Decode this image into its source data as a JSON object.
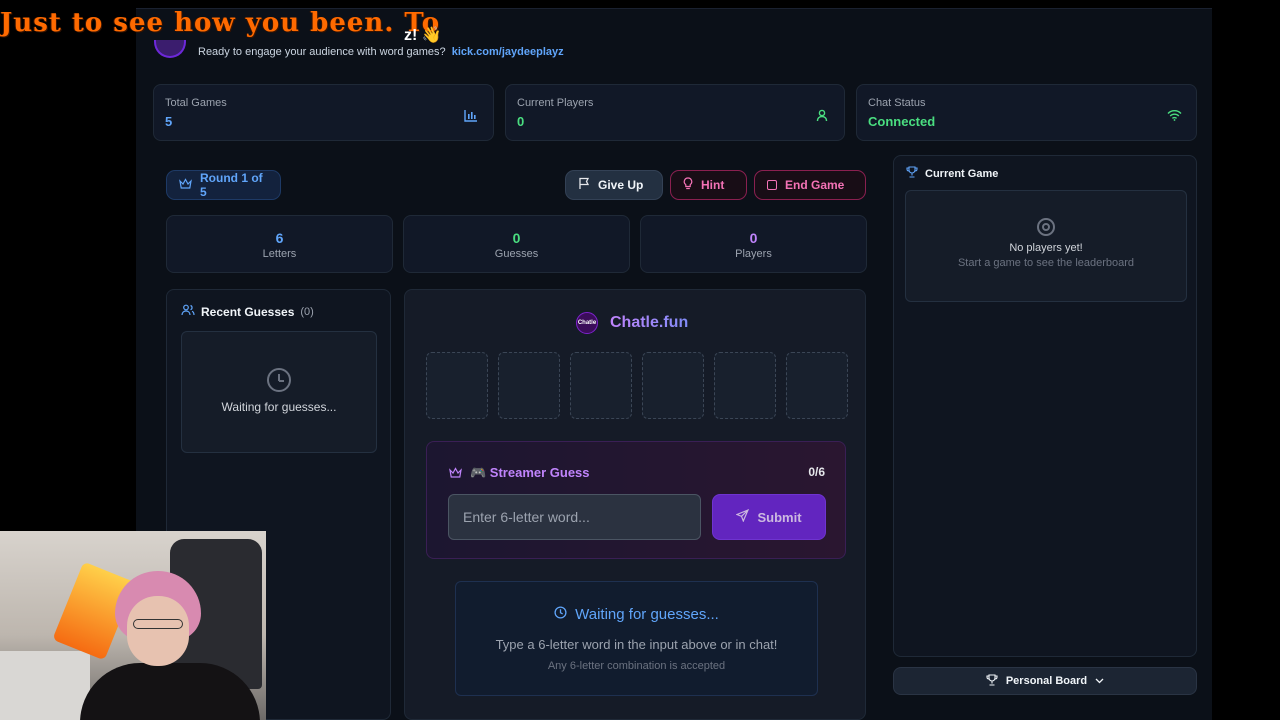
{
  "overlay": {
    "ticker": "Just to see how you been. To",
    "ticker_tail": "z! 👋"
  },
  "header": {
    "subtitle": "Ready to engage your audience with word games?",
    "channel_link": "kick.com/jaydeeplayz"
  },
  "stats": [
    {
      "label": "Total Games",
      "value": "5",
      "color": "#60a5fa",
      "icon": "bar-chart-icon"
    },
    {
      "label": "Current Players",
      "value": "0",
      "color": "#4ade80",
      "icon": "user-icon"
    },
    {
      "label": "Chat Status",
      "value": "Connected",
      "color": "#4ade80",
      "icon": "wifi-icon"
    }
  ],
  "controls": {
    "round": "Round 1 of 5",
    "give_up": "Give Up",
    "hint": "Hint",
    "end_game": "End Game"
  },
  "metrics": [
    {
      "value": "6",
      "label": "Letters",
      "color": "#60a5fa"
    },
    {
      "value": "0",
      "label": "Guesses",
      "color": "#4ade80"
    },
    {
      "value": "0",
      "label": "Players",
      "color": "#c084fc"
    }
  ],
  "recent_guesses": {
    "title": "Recent Guesses",
    "count": "(0)",
    "empty_text": "Waiting for guesses..."
  },
  "board": {
    "logo_text": "Chatle",
    "brand": "Chatle.fun",
    "streamer_title": "🎮 Streamer Guess",
    "attempts": "0/6",
    "input_placeholder": "Enter 6-letter word...",
    "submit": "Submit",
    "waiting_title": "Waiting for guesses...",
    "waiting_hint": "Type a 6-letter word in the input above or in chat!",
    "waiting_note": "Any 6-letter combination is accepted"
  },
  "current_game": {
    "title": "Current Game",
    "empty_title": "No players yet!",
    "empty_hint": "Start a game to see the leaderboard"
  },
  "personal_board": {
    "label": "Personal Board"
  }
}
